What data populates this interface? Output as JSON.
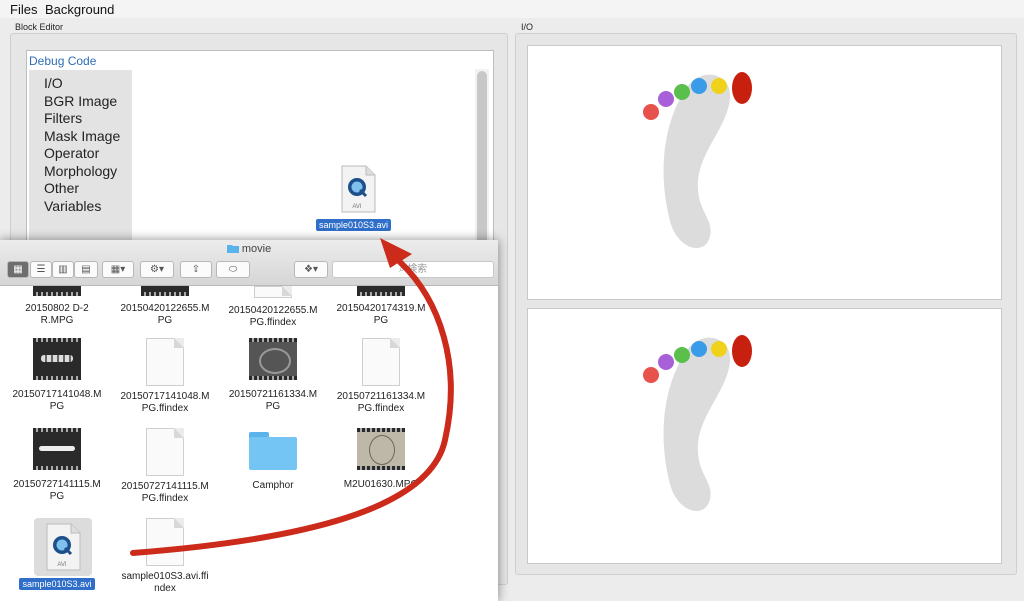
{
  "menu": {
    "files": "Files",
    "background": "Background"
  },
  "block_editor": {
    "title": "Block Editor",
    "debug_link": "Debug Code",
    "palette": [
      "I/O",
      "BGR Image",
      "Filters",
      "Mask Image",
      "Operator",
      "Morphology",
      "Other",
      "Variables"
    ],
    "dropped_file": {
      "icon_label": "AVI",
      "name": "sample010S3.avi"
    }
  },
  "io": {
    "title": "I/O"
  },
  "finder": {
    "title": "movie",
    "search_placeholder": "検索",
    "items": [
      {
        "name": "20150802 D-2\nR.MPG",
        "kind": "video"
      },
      {
        "name": "20150420122655.M\nPG",
        "kind": "video"
      },
      {
        "name": "20150420122655.M\nPG.ffindex",
        "kind": "doc"
      },
      {
        "name": "20150420174319.M\nPG",
        "kind": "video"
      },
      {
        "name": "20150717141048.M\nPG",
        "kind": "video"
      },
      {
        "name": "20150717141048.M\nPG.ffindex",
        "kind": "doc"
      },
      {
        "name": "20150721161334.M\nPG",
        "kind": "video"
      },
      {
        "name": "20150721161334.M\nPG.ffindex",
        "kind": "doc"
      },
      {
        "name": "20150727141115.M\nPG",
        "kind": "video"
      },
      {
        "name": "20150727141115.M\nPG.ffindex",
        "kind": "doc"
      },
      {
        "name": "Camphor",
        "kind": "folder"
      },
      {
        "name": "M2U01630.MPG",
        "kind": "video"
      },
      {
        "name": "sample010S3.avi",
        "kind": "avi",
        "selected": true
      },
      {
        "name": "sample010S3.avi.ffi\nndex",
        "kind": "doc"
      }
    ]
  },
  "colors": {
    "arrow": "#cc2a1a",
    "selection": "#2f6ec9",
    "link": "#2f6db6"
  }
}
